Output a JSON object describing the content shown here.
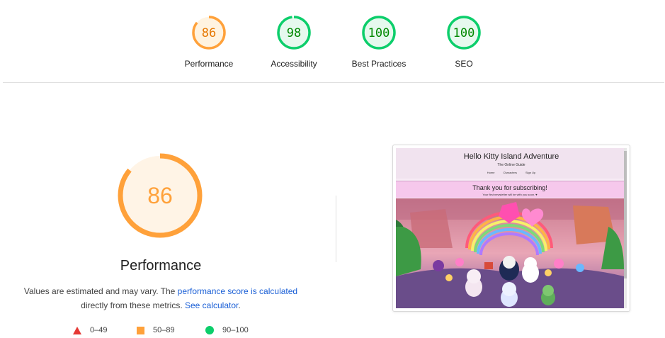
{
  "gauges": [
    {
      "label": "Performance",
      "score": "86",
      "value": 86,
      "status": "average",
      "color": "#e67700",
      "ring": "#ffa13a",
      "fill": "#fff3e0"
    },
    {
      "label": "Accessibility",
      "score": "98",
      "value": 98,
      "status": "pass",
      "color": "#008800",
      "ring": "#0cce6b",
      "fill": "#e6f9ee"
    },
    {
      "label": "Best Practices",
      "score": "100",
      "value": 100,
      "status": "pass",
      "color": "#008800",
      "ring": "#0cce6b",
      "fill": "#e6f9ee"
    },
    {
      "label": "SEO",
      "score": "100",
      "value": 100,
      "status": "pass",
      "color": "#008800",
      "ring": "#0cce6b",
      "fill": "#e6f9ee"
    }
  ],
  "performance": {
    "title": "Performance",
    "score": "86",
    "value": 86,
    "color": "#ffa13a",
    "text_color": "#ffa13a",
    "fill": "#fff4e6"
  },
  "description": {
    "prefix": "Values are estimated and may vary. The ",
    "link1": "performance score is calculated",
    "middle": "directly from these metrics. ",
    "link2": "See calculator",
    "suffix": "."
  },
  "legend": [
    {
      "range": "0–49",
      "icon": "triangle-icon",
      "color": "#e53935"
    },
    {
      "range": "50–89",
      "icon": "square-icon",
      "color": "#ffa13a"
    },
    {
      "range": "90–100",
      "icon": "circle-icon",
      "color": "#0cce6b"
    }
  ],
  "screenshot": {
    "site_title": "Hello Kitty Island Adventure",
    "site_subtitle": "The Online Guide",
    "nav": [
      "Home",
      "Characters",
      "Sign Up"
    ],
    "banner_title": "Thank you for subscribing!",
    "banner_subtitle": "Your first newsletter will be with you soon. ♥"
  }
}
